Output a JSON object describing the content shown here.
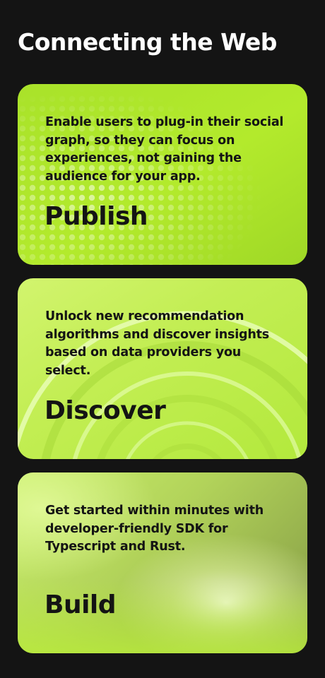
{
  "page": {
    "title": "Connecting the Web"
  },
  "cards": [
    {
      "heading": "Publish",
      "description": "Enable users to plug-in their social graph, so they can focus on experiences, not gaining the audience for your app.",
      "background": "dotted-pattern"
    },
    {
      "heading": "Discover",
      "description": "Unlock new recommendation algorithms and discover insights based on data providers you select.",
      "background": "concentric-arcs"
    },
    {
      "heading": "Build",
      "description": "Get started within minutes with developer-friendly SDK for Typescript and Rust.",
      "background": "gradient-glow"
    }
  ],
  "colors": {
    "page_background": "#141414",
    "title_text": "#ffffff",
    "card_text": "#141414",
    "accent_lime": "#b5ec2e"
  }
}
